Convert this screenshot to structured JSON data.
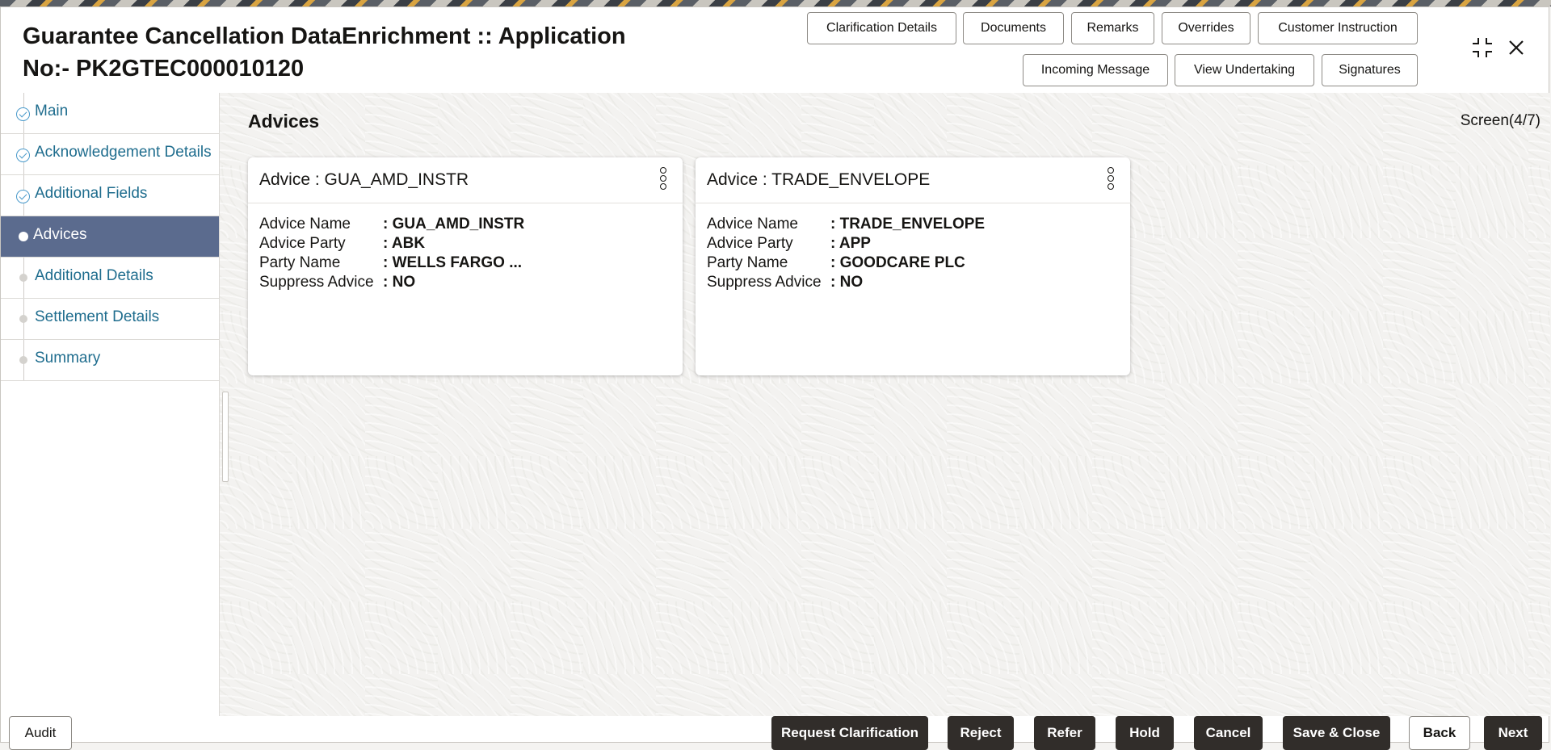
{
  "header": {
    "title_line1": "Guarantee Cancellation DataEnrichment :: Application",
    "title_line2": "No:- PK2GTEC000010120",
    "buttons_row1": [
      "Clarification Details",
      "Documents",
      "Remarks",
      "Overrides",
      "Customer Instruction"
    ],
    "buttons_row2": [
      "Incoming Message",
      "View Undertaking",
      "Signatures"
    ],
    "maximize_icon": "collapse-arrows-icon",
    "close_icon": "close-icon"
  },
  "sidebar": {
    "items": [
      {
        "label": "Main",
        "status": "complete"
      },
      {
        "label": "Acknowledgement Details",
        "status": "complete"
      },
      {
        "label": "Additional Fields",
        "status": "complete"
      },
      {
        "label": "Advices",
        "status": "active"
      },
      {
        "label": "Additional Details",
        "status": "pending"
      },
      {
        "label": "Settlement Details",
        "status": "pending"
      },
      {
        "label": "Summary",
        "status": "pending"
      }
    ]
  },
  "main": {
    "section_title": "Advices",
    "screen_indicator": "Screen(4/7)",
    "cards": [
      {
        "title": "Advice : GUA_AMD_INSTR",
        "rows": [
          {
            "key": "Advice Name",
            "value": ": GUA_AMD_INSTR"
          },
          {
            "key": "Advice Party",
            "value": ": ABK"
          },
          {
            "key": "Party Name",
            "value": ": WELLS FARGO ..."
          },
          {
            "key": "Suppress Advice",
            "value": ": NO"
          }
        ]
      },
      {
        "title": "Advice : TRADE_ENVELOPE",
        "rows": [
          {
            "key": "Advice Name",
            "value": ": TRADE_ENVELOPE"
          },
          {
            "key": "Advice Party",
            "value": ": APP"
          },
          {
            "key": "Party Name",
            "value": ": GOODCARE PLC"
          },
          {
            "key": "Suppress Advice",
            "value": ": NO"
          }
        ]
      }
    ]
  },
  "footer": {
    "audit": "Audit",
    "request_clarification": "Request Clarification",
    "reject": "Reject",
    "refer": "Refer",
    "hold": "Hold",
    "cancel": "Cancel",
    "save_close": "Save & Close",
    "back": "Back",
    "next": "Next"
  },
  "colors": {
    "active_nav": "#5b6b8e",
    "link": "#1f6d8e",
    "dark_button": "#312d2a"
  }
}
